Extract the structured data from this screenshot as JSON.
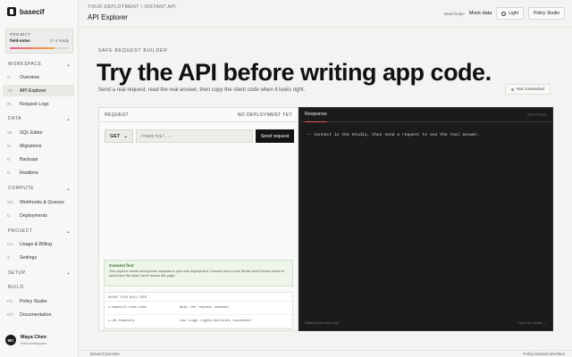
{
  "brand": {
    "name": "basecif"
  },
  "project": {
    "kicker": "PROJECT",
    "name": "field-notes",
    "ready": "3 / 4 ready",
    "progress": 0.75
  },
  "nav": {
    "workspace": {
      "label": "WORKSPACE",
      "items": [
        {
          "abbr": "O",
          "label": "Overview"
        },
        {
          "abbr": "AE",
          "label": "API Explorer"
        },
        {
          "abbr": "RL",
          "label": "Request Logs"
        }
      ]
    },
    "data": {
      "label": "DATA",
      "items": [
        {
          "abbr": "SE",
          "label": "SQL Editor"
        },
        {
          "abbr": "M",
          "label": "Migrations"
        },
        {
          "abbr": "B",
          "label": "Backups"
        },
        {
          "abbr": "R",
          "label": "Realtime"
        }
      ]
    },
    "compute": {
      "label": "COMPUTE",
      "items": [
        {
          "abbr": "WA",
          "label": "Webhooks & Queues"
        },
        {
          "abbr": "D",
          "label": "Deployments"
        }
      ]
    },
    "project": {
      "label": "PROJECT",
      "items": [
        {
          "abbr": "UA",
          "label": "Usage & Billing"
        },
        {
          "abbr": "S",
          "label": "Settings"
        }
      ]
    },
    "setup": {
      "label": "SETUP"
    },
    "build": {
      "label": "BUILD",
      "items": [
        {
          "abbr": "PS",
          "label": "Policy Studio"
        },
        {
          "abbr": "DO",
          "label": "Documentation"
        }
      ]
    }
  },
  "user": {
    "initials": "MC",
    "name": "Maya Chen",
    "role": "Field workspace"
  },
  "topbar": {
    "breadcrumb": "YOUR DEPLOYMENT / INSTANT API",
    "title": "API Explorer",
    "help": "Need help?",
    "mock_data": "Mock data",
    "theme": "Light",
    "policy_studio": "Policy Studio"
  },
  "hero": {
    "kicker": "SAFE REQUEST BUILDER",
    "title": "Try the API before writing app code.",
    "subtitle": "Send a real request, read the real answer, then copy the client code when it looks right.",
    "status": "Not connected"
  },
  "request": {
    "label": "REQUEST",
    "deployment": "NO DEPLOYMENT YET",
    "method": "GET",
    "path": "/rest/v1/...",
    "send": "Send request",
    "note_title": "Connect first",
    "note_body": "This explorer sends anonymous requests to your own deployment. Connect once in the Studio and it knows where to send them the token never leaves this page.",
    "table_head": "WHAT YOU WILL SEE",
    "rows": [
      {
        "c1": "x-basecif-rows-seen",
        "c2": "what the request scanned"
      },
      {
        "c1": "x-db-timeouts",
        "c2": "how rough rights/policies succeeded"
      }
    ]
  },
  "response": {
    "tab": "Response",
    "state": "WAITING",
    "body": "-- Connect in the Studio, then send a request to see the real answer.",
    "footer_left": "Nothing has been sent",
    "footer_right": "Open the Studio →"
  },
  "footer": {
    "left": "BaseCif preview",
    "right": "Policy-backed interface"
  }
}
